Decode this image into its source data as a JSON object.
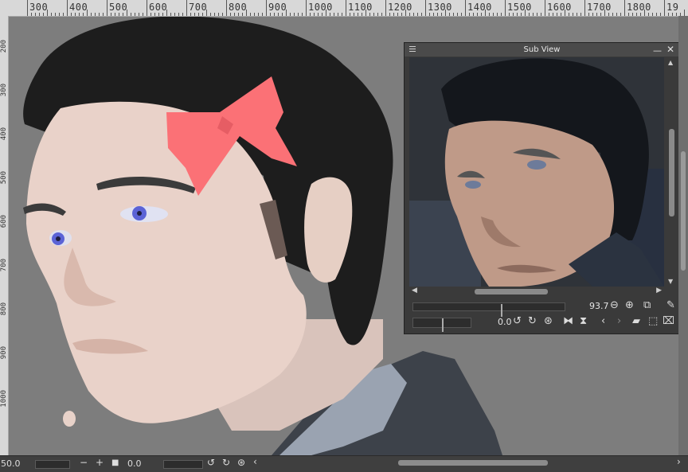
{
  "ruler": {
    "labels": [
      "300",
      "400",
      "500",
      "600",
      "700",
      "800",
      "900",
      "1000",
      "1100",
      "1200",
      "1300",
      "1400",
      "1500",
      "1600",
      "1700",
      "1800",
      "19"
    ],
    "left_labels": [
      "200",
      "300",
      "400",
      "500",
      "600",
      "700",
      "800",
      "900",
      "1000"
    ]
  },
  "subview": {
    "title": "Sub View",
    "zoom_value": "93.7",
    "rotation_value": "0.0"
  },
  "status": {
    "zoom_value": "50.0",
    "angle_value": "0.0"
  },
  "colors": {
    "background": "#7d7d7d",
    "hair": "#1c1c1c",
    "skin": "#e9d2c9",
    "bow": "#fb7176",
    "eye": "#5b63d6",
    "coat": "#3c4047"
  }
}
